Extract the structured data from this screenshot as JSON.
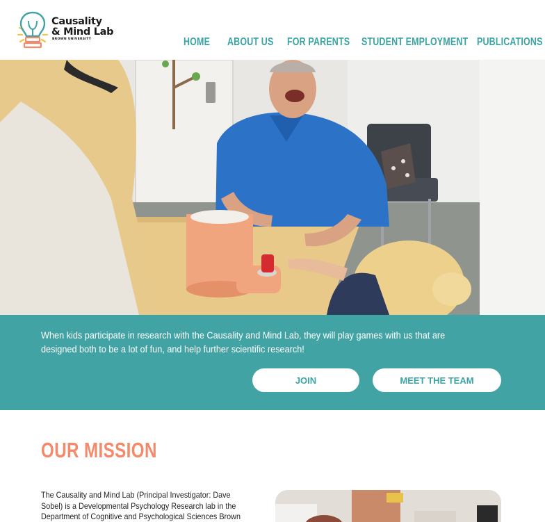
{
  "logo": {
    "title_line1": "Causality",
    "title_line2": "& Mind Lab",
    "subtitle": "BROWN UNIVERSITY",
    "icon": "lightbulb-logo-icon"
  },
  "nav": {
    "items": [
      {
        "label": "HOME"
      },
      {
        "label": "ABOUT US"
      },
      {
        "label": "FOR PARENTS"
      },
      {
        "label": "STUDENT EMPLOYMENT"
      },
      {
        "label": "PUBLICATIONS"
      }
    ]
  },
  "hero": {
    "image": "photo of researcher and children playing with a causal toy"
  },
  "band": {
    "text": "When kids participate in research with the Causality and Mind Lab, they will play games with us that are designed both to be a lot of fun, and help further scientific research!",
    "join_label": "JOIN",
    "team_label": "MEET THE TEAM"
  },
  "mission": {
    "title": "OUR MISSION",
    "text": "The Causality and Mind Lab (Principal Investigator: Dave Sobel) is a Developmental Psychology Research lab in the Department of Cognitive and Psychological Sciences Brown University. We"
  },
  "colors": {
    "teal": "#42a3a4",
    "nav_teal": "#3aa3a3",
    "coral": "#f38a6b"
  }
}
